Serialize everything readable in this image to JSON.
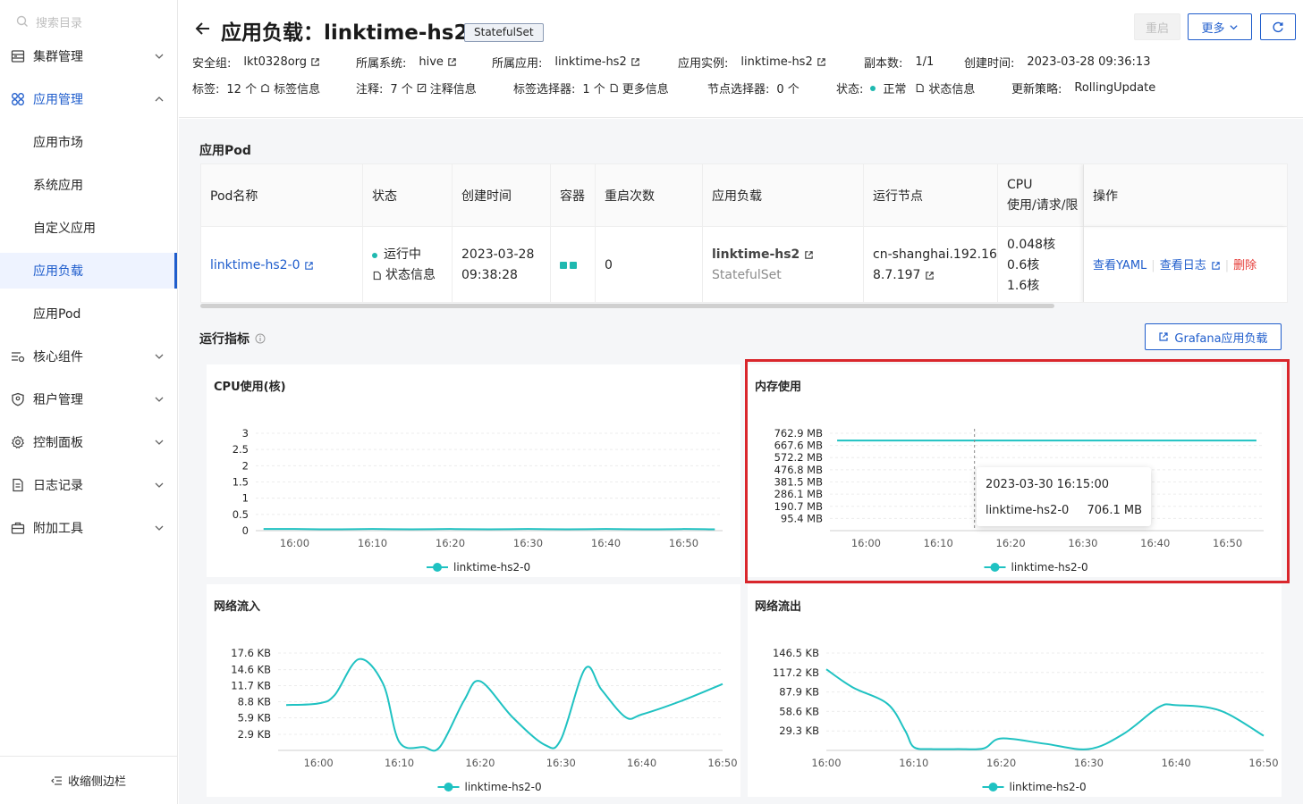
{
  "sidebar": {
    "search_placeholder": "搜索目录",
    "items": [
      {
        "label": "集群管理",
        "icon": "server-icon",
        "has_chevron": true
      },
      {
        "label": "应用管理",
        "icon": "apps-icon",
        "has_chevron": true,
        "expanded": true
      },
      {
        "label": "应用市场"
      },
      {
        "label": "系统应用"
      },
      {
        "label": "自定义应用"
      },
      {
        "label": "应用负载",
        "active": true
      },
      {
        "label": "应用Pod"
      },
      {
        "label": "核心组件",
        "icon": "components-icon",
        "has_chevron": true
      },
      {
        "label": "租户管理",
        "icon": "shield-icon",
        "has_chevron": true
      },
      {
        "label": "控制面板",
        "icon": "gear-icon",
        "has_chevron": true
      },
      {
        "label": "日志记录",
        "icon": "document-icon",
        "has_chevron": true
      },
      {
        "label": "附加工具",
        "icon": "toolbox-icon",
        "has_chevron": true
      }
    ],
    "collapse_label": "收缩侧边栏"
  },
  "header": {
    "title": "应用负载：linktime-hs2",
    "kind_tag": "StatefulSet",
    "restart_label": "重启",
    "more_label": "更多",
    "meta_row1": [
      {
        "key": "安全组:",
        "value": "lkt0328org",
        "link": true
      },
      {
        "key": "所属系统:",
        "value": "hive",
        "link": true
      },
      {
        "key": "所属应用:",
        "value": "linktime-hs2",
        "link": true
      },
      {
        "key": "应用实例:",
        "value": "linktime-hs2",
        "link": true
      },
      {
        "key": "副本数:",
        "value": "1/1"
      },
      {
        "key": "创建时间:",
        "value": "2023-03-28 09:36:13"
      }
    ],
    "meta_row2": [
      {
        "key": "标签:",
        "value": "12 个",
        "extra": "标签信息"
      },
      {
        "key": "注释:",
        "value": "7 个",
        "extra": "注释信息"
      },
      {
        "key": "标签选择器:",
        "value": "1 个",
        "extra": "更多信息"
      },
      {
        "key": "节点选择器:",
        "value": "0 个"
      },
      {
        "key": "状态:",
        "value": "正常",
        "extra": "状态信息"
      },
      {
        "key": "更新策略:",
        "value": "RollingUpdate"
      }
    ]
  },
  "pods": {
    "section_title": "应用Pod",
    "columns": [
      "Pod名称",
      "状态",
      "创建时间",
      "容器",
      "重启次数",
      "应用负载",
      "运行节点",
      "CPU\n使用/请求/限",
      "操作"
    ],
    "row": {
      "name": "linktime-hs2-0",
      "status": "运行中",
      "status_info": "状态信息",
      "created_date": "2023-03-28",
      "created_time": "09:38:28",
      "restarts": "0",
      "workload_name": "linktime-hs2",
      "workload_kind": "StatefulSet",
      "node_line1": "cn-shanghai.192.16",
      "node_line2": "8.7.197",
      "cpu_used": "0.048核",
      "cpu_request": "0.6核",
      "cpu_limit": "1.6核",
      "action_yaml": "查看YAML",
      "action_log": "查看日志",
      "action_delete": "删除"
    }
  },
  "metrics": {
    "section_title": "运行指标",
    "grafana_label": "Grafana应用负载",
    "tooltip": {
      "time": "2023-03-30 16:15:00",
      "series": "linktime-hs2-0",
      "value": "706.1 MB"
    }
  },
  "colors": {
    "accent": "#1f5dcc",
    "series": "#1fc2c2",
    "danger": "#e53935"
  },
  "chart_data": [
    {
      "type": "line",
      "title": "CPU使用(核)",
      "x_ticks": [
        "16:00",
        "16:10",
        "16:20",
        "16:30",
        "16:40",
        "16:50"
      ],
      "y_ticks": [
        "0",
        "0.5",
        "1",
        "1.5",
        "2",
        "2.5",
        "3"
      ],
      "ylim": [
        0,
        3
      ],
      "legend": [
        "linktime-hs2-0"
      ],
      "series": [
        {
          "name": "linktime-hs2-0",
          "x": [
            "15:56",
            "16:00",
            "16:05",
            "16:10",
            "16:15",
            "16:20",
            "16:25",
            "16:30",
            "16:35",
            "16:40",
            "16:45",
            "16:50",
            "16:54"
          ],
          "y": [
            0.05,
            0.05,
            0.04,
            0.05,
            0.04,
            0.05,
            0.04,
            0.05,
            0.04,
            0.05,
            0.04,
            0.05,
            0.04
          ]
        }
      ]
    },
    {
      "type": "line",
      "title": "内存使用",
      "x_ticks": [
        "16:00",
        "16:10",
        "16:20",
        "16:30",
        "16:40",
        "16:50"
      ],
      "y_ticks": [
        "95.4 MB",
        "190.7 MB",
        "286.1 MB",
        "381.5 MB",
        "476.8 MB",
        "572.2 MB",
        "667.6 MB",
        "762.9 MB"
      ],
      "ylim": [
        0,
        762.9
      ],
      "legend": [
        "linktime-hs2-0"
      ],
      "series": [
        {
          "name": "linktime-hs2-0",
          "x": [
            "15:56",
            "16:15",
            "16:54"
          ],
          "y": [
            706.1,
            706.1,
            706.1
          ]
        }
      ]
    },
    {
      "type": "line",
      "title": "网络流入",
      "x_ticks": [
        "16:00",
        "16:10",
        "16:20",
        "16:30",
        "16:40",
        "16:50"
      ],
      "y_ticks": [
        "2.9 KB",
        "5.9 KB",
        "8.8 KB",
        "11.7 KB",
        "14.6 KB",
        "17.6 KB"
      ],
      "ylim": [
        0,
        17.6
      ],
      "legend": [
        "linktime-hs2-0"
      ],
      "series": [
        {
          "name": "linktime-hs2-0",
          "x": [
            "15:56",
            "16:00",
            "16:02",
            "16:05",
            "16:08",
            "16:10",
            "16:13",
            "16:15",
            "16:18",
            "16:20",
            "16:24",
            "16:28",
            "16:30",
            "16:33",
            "16:35",
            "16:38",
            "16:40",
            "16:45",
            "16:50"
          ],
          "y": [
            8.2,
            8.5,
            10.0,
            16.5,
            12.0,
            1.5,
            0.6,
            0.6,
            9.0,
            12.5,
            6.0,
            1.0,
            2.0,
            14.8,
            11.0,
            6.0,
            6.5,
            9.0,
            12.0
          ]
        }
      ]
    },
    {
      "type": "line",
      "title": "网络流出",
      "x_ticks": [
        "16:00",
        "16:10",
        "16:20",
        "16:30",
        "16:40",
        "16:50"
      ],
      "y_ticks": [
        "29.3 KB",
        "58.6 KB",
        "87.9 KB",
        "117.2 KB",
        "146.5 KB"
      ],
      "ylim": [
        0,
        146.5
      ],
      "legend": [
        "linktime-hs2-0"
      ],
      "series": [
        {
          "name": "linktime-hs2-0",
          "x": [
            "16:00",
            "16:03",
            "16:07",
            "16:09",
            "16:10",
            "16:12",
            "16:15",
            "16:18",
            "16:20",
            "16:25",
            "16:30",
            "16:34",
            "16:38",
            "16:40",
            "16:45",
            "16:50"
          ],
          "y": [
            122,
            95,
            70,
            30,
            5,
            2,
            2,
            3,
            18,
            10,
            2,
            25,
            65,
            68,
            60,
            22
          ]
        }
      ]
    }
  ]
}
